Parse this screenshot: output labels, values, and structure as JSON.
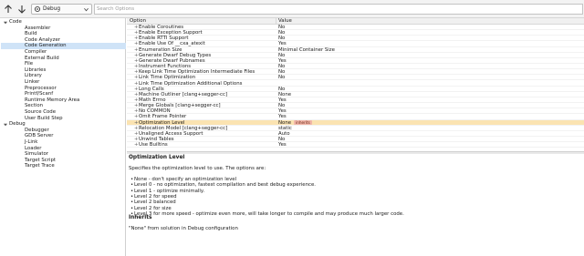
{
  "toolbar": {
    "back_icon": "arrow-up-icon",
    "forward_icon": "arrow-down-icon",
    "configuration": "Debug",
    "search_placeholder": "Search Options"
  },
  "tree": {
    "groups": [
      {
        "label": "Code",
        "expanded": true,
        "items": [
          "Assembler",
          "Build",
          "Code Analyzer",
          "Code Generation",
          "Compiler",
          "External Build",
          "File",
          "Libraries",
          "Library",
          "Linker",
          "Preprocessor",
          "Printf/Scanf",
          "Runtime Memory Area",
          "Section",
          "Source Code",
          "User Build Step"
        ]
      },
      {
        "label": "Debug",
        "expanded": true,
        "items": [
          "Debugger",
          "GDB Server",
          "J-Link",
          "Loader",
          "Simulator",
          "Target Script",
          "Target Trace"
        ]
      }
    ],
    "selected": "Code Generation"
  },
  "grid": {
    "headers": {
      "option": "Option",
      "value": "Value"
    },
    "rows": [
      {
        "option": "Enable Coroutines",
        "value": "No"
      },
      {
        "option": "Enable Exception Support",
        "value": "No"
      },
      {
        "option": "Enable RTTI Support",
        "value": "No"
      },
      {
        "option": "Enable Use Of __cxa_atexit",
        "value": "Yes"
      },
      {
        "option": "Enumeration Size",
        "value": "Minimal Container Size"
      },
      {
        "option": "Generate Dwarf Debug Types",
        "value": "No"
      },
      {
        "option": "Generate Dwarf Pubnames",
        "value": "Yes"
      },
      {
        "option": "Instrument Functions",
        "value": "No"
      },
      {
        "option": "Keep Link Time Optimization Intermediate Files",
        "value": "No"
      },
      {
        "option": "Link Time Optimization",
        "value": "No"
      },
      {
        "option": "Link Time Optimization Additional Options",
        "value": ""
      },
      {
        "option": "Long Calls",
        "value": "No"
      },
      {
        "option": "Machine Outliner [clang+segger-cc]",
        "value": "None"
      },
      {
        "option": "Math Errno",
        "value": "Yes"
      },
      {
        "option": "Merge Globals [clang+segger-cc]",
        "value": "No"
      },
      {
        "option": "No COMMON",
        "value": "Yes"
      },
      {
        "option": "Omit Frame Pointer",
        "value": "Yes"
      },
      {
        "option": "Optimization Level",
        "value": "None",
        "badge": "inherits"
      },
      {
        "option": "Relocation Model [clang+segger-cc]",
        "value": "static"
      },
      {
        "option": "Unaligned Access Support",
        "value": "Auto"
      },
      {
        "option": "Unwind Tables",
        "value": "No"
      },
      {
        "option": "Use Builtins",
        "value": "Yes"
      }
    ],
    "selected_index": 17
  },
  "description": {
    "title": "Optimization Level",
    "intro": "Specifies the optimization level to use. The options are:",
    "items": [
      "None - don't specify an optimization level",
      "Level 0 - no optimization, fastest compilation and best debug experience.",
      "Level 1 - optimize minimally.",
      "Level 2 for speed",
      "Level 2 balanced",
      "Level 2 for size",
      "Level 3 for more speed - optimize even more, will take longer to compile and may produce much larger code."
    ],
    "inherits_title": "Inherits",
    "inherits_text": "\"None\" from solution in Debug configuration"
  },
  "colors": {
    "selected_tree": "#cfe3f7",
    "selected_row": "#fbe3b1",
    "badge": "#f1b6a8"
  }
}
